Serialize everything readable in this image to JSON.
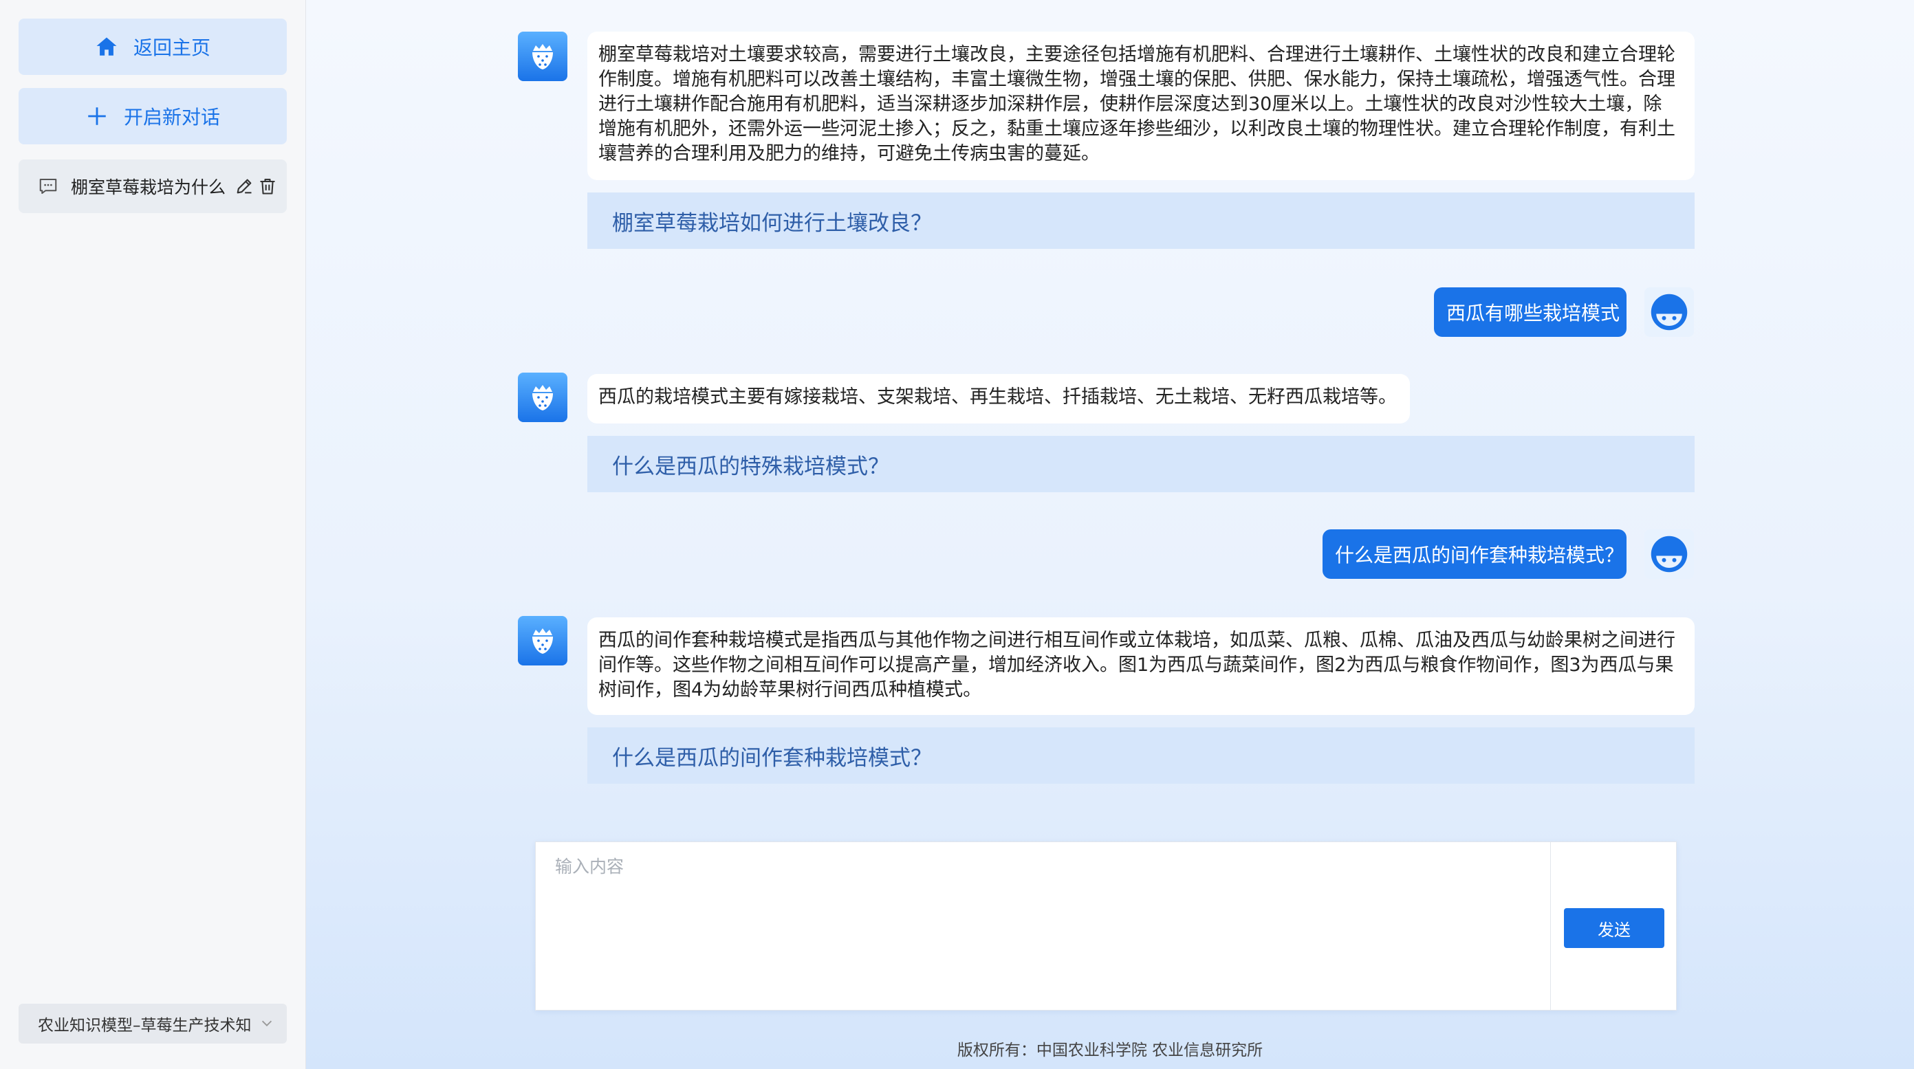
{
  "sidebar": {
    "home_label": "返回主页",
    "new_chat_label": "开启新对话",
    "history": [
      {
        "title": "棚室草莓栽培为什么"
      }
    ],
    "model_select_value": "农业知识模型–草莓生产技术知"
  },
  "messages": [
    {
      "role": "bot",
      "text": "棚室草莓栽培对土壤要求较高，需要进行土壤改良，主要途径包括增施有机肥料、合理进行土壤耕作、土壤性状的改良和建立合理轮作制度。增施有机肥料可以改善土壤结构，丰富土壤微生物，增强土壤的保肥、供肥、保水能力，保持土壤疏松，增强透气性。合理进行土壤耕作配合施用有机肥料，适当深耕逐步加深耕作层，使耕作层深度达到30厘米以上。土壤性状的改良对沙性较大土壤，除增施有机肥外，还需外运一些河泥土掺入；反之，黏重土壤应逐年掺些细沙，以利改良土壤的物理性状。建立合理轮作制度，有利土壤营养的合理利用及肥力的维持，可避免土传病虫害的蔓延。",
      "suggestion": "棚室草莓栽培如何进行土壤改良？"
    },
    {
      "role": "user",
      "text": "西瓜有哪些栽培模式"
    },
    {
      "role": "bot",
      "text": "西瓜的栽培模式主要有嫁接栽培、支架栽培、再生栽培、扦插栽培、无土栽培、无籽西瓜栽培等。",
      "suggestion": "什么是西瓜的特殊栽培模式？"
    },
    {
      "role": "user",
      "text": "什么是西瓜的间作套种栽培模式？"
    },
    {
      "role": "bot",
      "text": "西瓜的间作套种栽培模式是指西瓜与其他作物之间进行相互间作或立体栽培，如瓜菜、瓜粮、瓜棉、瓜油及西瓜与幼龄果树之间进行间作等。这些作物之间相互间作可以提高产量，增加经济收入。图1为西瓜与蔬菜间作，图2为西瓜与粮食作物间作，图3为西瓜与果树间作，图4为幼龄苹果树行间西瓜种植模式。",
      "suggestion": "什么是西瓜的间作套种栽培模式？"
    }
  ],
  "composer": {
    "placeholder": "输入内容",
    "send_label": "发送"
  },
  "footer": "版权所有：中国农业科学院 农业信息研究所",
  "colors": {
    "accent": "#1a73e8",
    "suggestion_bg": "#d6e6fb",
    "suggestion_text": "#2e5ea8"
  },
  "icons": {
    "home": "home-icon",
    "new_chat": "plus-icon",
    "history": "chat-bubble-icon",
    "edit": "edit-icon",
    "delete": "trash-icon",
    "select": "chevron-down-icon",
    "bot_avatar": "strawberry-icon",
    "user_avatar": "user-face-icon"
  }
}
